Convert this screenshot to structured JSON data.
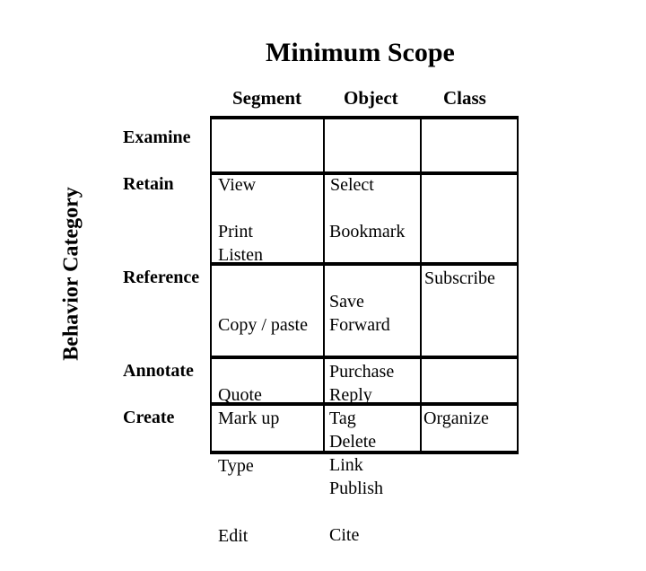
{
  "title": "Minimum Scope",
  "y_axis_label": "Behavior Category",
  "columns": [
    "Segment",
    "Object",
    "Class"
  ],
  "rows": [
    {
      "label": "Examine",
      "segment": [
        "View",
        "Listen"
      ],
      "object": [
        "Select"
      ],
      "class": []
    },
    {
      "label": "Retain",
      "segment": [
        "Print"
      ],
      "object": [
        "Bookmark",
        "Save",
        "Purchase",
        "Delete"
      ],
      "class": [
        "Subscribe"
      ]
    },
    {
      "label": "Reference",
      "segment": [
        "Copy / paste",
        "Quote"
      ],
      "object": [
        "Forward",
        "Reply",
        "Link",
        "Cite"
      ],
      "class": []
    },
    {
      "label": "Annotate",
      "segment": [
        "Mark up"
      ],
      "object": [
        "Tag",
        "Publish"
      ],
      "class": [
        "Organize"
      ]
    },
    {
      "label": "Create",
      "segment": [
        "Type",
        "Edit"
      ],
      "object": [],
      "class": []
    }
  ]
}
